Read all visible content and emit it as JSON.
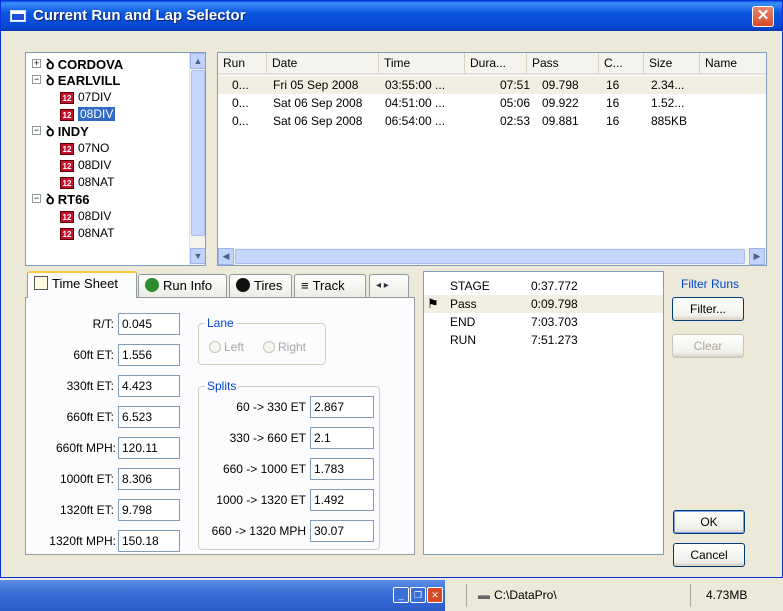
{
  "window": {
    "title": "Current Run and Lap Selector",
    "close_label": "✕"
  },
  "tree": {
    "groups": [
      {
        "name": "CORDOVA",
        "expander": "+",
        "items": []
      },
      {
        "name": "EARLVILL",
        "expander": "−",
        "items": [
          "07DIV",
          "08DIV"
        ]
      },
      {
        "name": "INDY",
        "expander": "−",
        "items": [
          "07NO",
          "08DIV",
          "08NAT"
        ]
      },
      {
        "name": "RT66",
        "expander": "−",
        "items": [
          "08DIV",
          "08NAT"
        ]
      }
    ],
    "selected": "EARLVILL/08DIV",
    "item_icon_text": "12"
  },
  "runs": {
    "columns": [
      "Run",
      "Date",
      "Time",
      "Dura...",
      "Pass",
      "C...",
      "Size",
      "Name"
    ],
    "rows": [
      {
        "run": "0...",
        "date": "Fri 05 Sep 2008",
        "time": "03:55:00 ...",
        "duration": "07:51",
        "pass": "09.798",
        "c": "16",
        "size": "2.34...",
        "name": ""
      },
      {
        "run": "0...",
        "date": "Sat 06 Sep 2008",
        "time": "04:51:00 ...",
        "duration": "05:06",
        "pass": "09.922",
        "c": "16",
        "size": "1.52...",
        "name": ""
      },
      {
        "run": "0...",
        "date": "Sat 06 Sep 2008",
        "time": "06:54:00 ...",
        "duration": "02:53",
        "pass": "09.881",
        "c": "16",
        "size": "885KB",
        "name": ""
      }
    ]
  },
  "tabs": [
    {
      "label": "Time Sheet",
      "active": true
    },
    {
      "label": "Run Info",
      "active": false
    },
    {
      "label": "Tires",
      "active": false
    },
    {
      "label": "Track",
      "active": false
    }
  ],
  "timesheet": {
    "fields": [
      {
        "label": "R/T:",
        "value": "0.045"
      },
      {
        "label": "60ft ET:",
        "value": "1.556"
      },
      {
        "label": "330ft ET:",
        "value": "4.423"
      },
      {
        "label": "660ft ET:",
        "value": "6.523"
      },
      {
        "label": "660ft MPH:",
        "value": "120.11"
      },
      {
        "label": "1000ft ET:",
        "value": "8.306"
      },
      {
        "label": "1320ft ET:",
        "value": "9.798"
      },
      {
        "label": "1320ft MPH:",
        "value": "150.18"
      }
    ],
    "lane": {
      "title": "Lane",
      "left": "Left",
      "right": "Right"
    },
    "splits": {
      "title": "Splits",
      "rows": [
        {
          "label": "60 -> 330 ET",
          "value": "2.867"
        },
        {
          "label": "330 -> 660 ET",
          "value": "2.1"
        },
        {
          "label": "660 -> 1000 ET",
          "value": "1.783"
        },
        {
          "label": "1000 -> 1320 ET",
          "value": "1.492"
        },
        {
          "label": "660 -> 1320 MPH",
          "value": "30.07"
        }
      ]
    }
  },
  "stages": [
    {
      "name": "STAGE",
      "time": "0:37.772",
      "flag": false
    },
    {
      "name": "Pass",
      "time": "0:09.798",
      "flag": true
    },
    {
      "name": "END",
      "time": "7:03.703",
      "flag": false
    },
    {
      "name": "RUN",
      "time": "7:51.273",
      "flag": false
    }
  ],
  "filter": {
    "title": "Filter Runs",
    "filter_label": "Filter...",
    "clear_label": "Clear"
  },
  "buttons": {
    "ok": "OK",
    "cancel": "Cancel"
  },
  "taskbar": {
    "path": "C:\\DataPro\\",
    "memory": "4.73MB"
  },
  "colors": {
    "title_bar": "#0b56e0",
    "selection": "#316ac5",
    "group_title": "#0046d5"
  }
}
